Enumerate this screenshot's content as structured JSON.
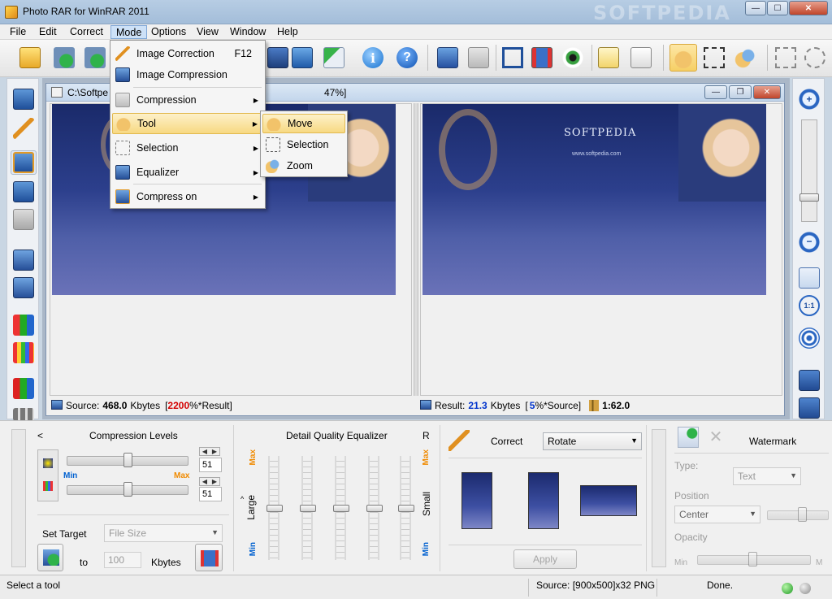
{
  "window": {
    "title": "Photo RAR for WinRAR 2011",
    "watermark": "SOFTPEDIA"
  },
  "menu": [
    "File",
    "Edit",
    "Correct",
    "Mode",
    "Options",
    "View",
    "Window",
    "Help"
  ],
  "mode_menu": {
    "items": [
      {
        "label": "Image Correction",
        "shortcut": "F12"
      },
      {
        "label": "Image Compression"
      },
      {
        "label": "Compression"
      },
      {
        "label": "Tool"
      },
      {
        "label": "Selection"
      },
      {
        "label": "Equalizer"
      },
      {
        "label": "Compress on"
      }
    ]
  },
  "tool_submenu": {
    "items": [
      "Move",
      "Selection",
      "Zoom"
    ]
  },
  "document": {
    "title_left": "C:\\Softpe",
    "title_right": "47%]",
    "source_label": "Source:",
    "source_value": "468.0",
    "source_unit": "Kbytes",
    "source_pct_open": "[",
    "source_pct": "2200",
    "source_pct_tail": "%*Result]",
    "result_label": "Result:",
    "result_value": "21.3",
    "result_unit": "Kbytes",
    "result_pct_open": "[",
    "result_pct": "5",
    "result_pct_tail": "%*Source]",
    "ratio": "1:62.0",
    "image_brand": "SOFTPEDIA",
    "image_url": "www.softpedia.com"
  },
  "compression": {
    "collapse": "<",
    "title": "Compression Levels",
    "min": "Min",
    "max": "Max",
    "level1": "51",
    "level2": "51",
    "level1_fraction": 0.51,
    "level2_fraction": 0.51,
    "set_target": "Set Target",
    "target_type": "File Size",
    "to": "to",
    "target_value": "100",
    "target_unit": "Kbytes"
  },
  "equalizer": {
    "title": "Detail Quality Equalizer",
    "r": "R",
    "max": "Max",
    "min": "Min",
    "large": "Large",
    "small": "Small",
    "caret": "^"
  },
  "correct": {
    "label": "Correct",
    "operation": "Rotate",
    "apply": "Apply"
  },
  "watermark": {
    "title": "Watermark",
    "type_label": "Type:",
    "type_value": "Text",
    "position_label": "Position",
    "position_value": "Center",
    "opacity_label": "Opacity",
    "min": "Min",
    "max": "M"
  },
  "status": {
    "hint": "Select a tool",
    "source_info": "Source: [900x500]x32 PNG",
    "state": "Done."
  },
  "colors": {
    "accent_red": "#d40000",
    "accent_blue": "#0033cc",
    "orange": "#f08a00",
    "blue_label": "#0060d0"
  }
}
